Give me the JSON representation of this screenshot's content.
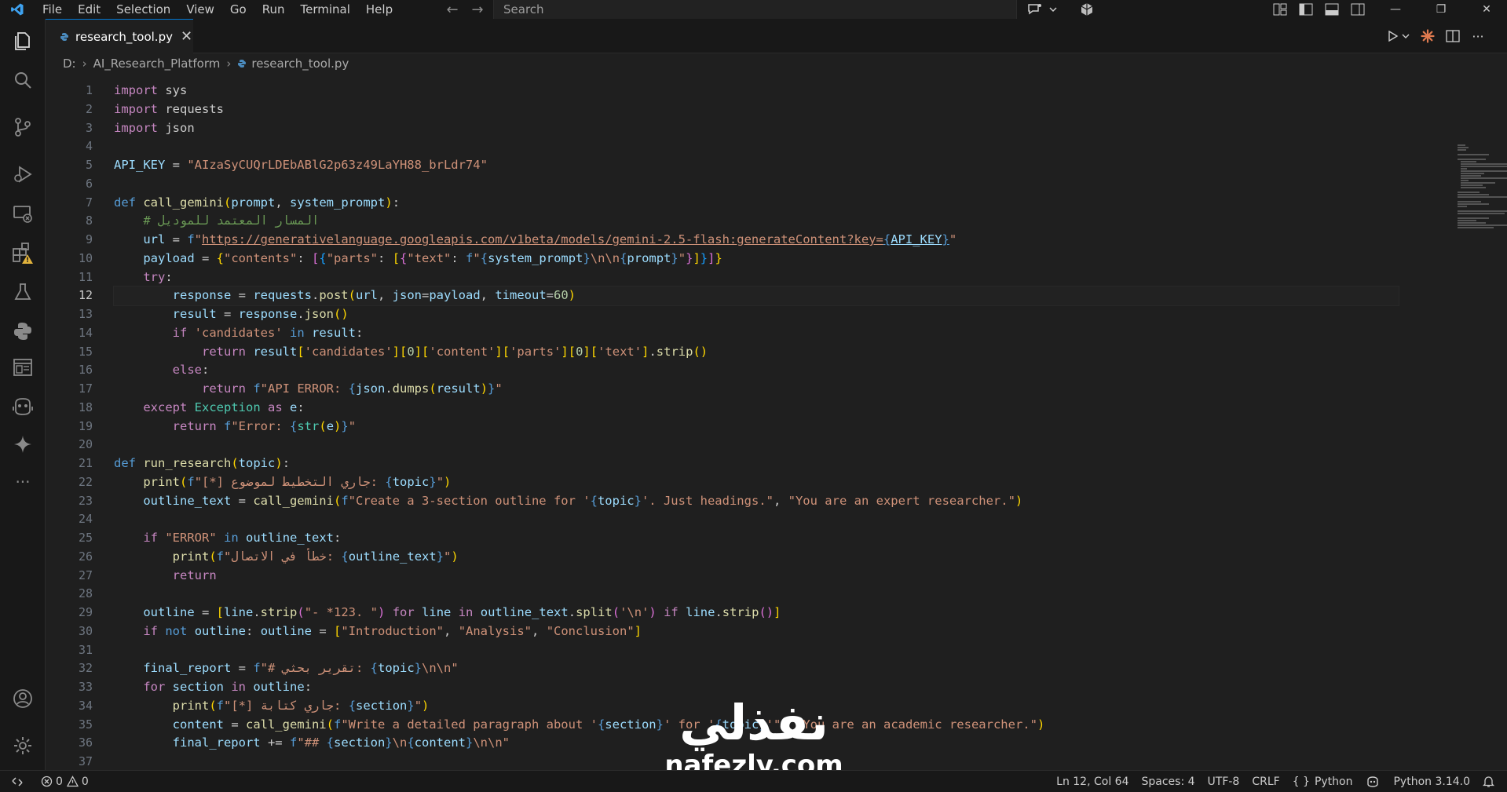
{
  "colors": {
    "accent": "#0078d4",
    "keyword": "#c586c0",
    "string": "#ce9178",
    "function": "#dcdcaa",
    "variable": "#9cdcfe",
    "builtin_type": "#4ec9b0",
    "number": "#b5cea8",
    "comment": "#6a9955"
  },
  "titlebar": {
    "menu": [
      "File",
      "Edit",
      "Selection",
      "View",
      "Go",
      "Run",
      "Terminal",
      "Help"
    ],
    "search_placeholder": "Search",
    "icons": [
      "vscode-logo-icon",
      "back-arrow-icon",
      "forward-arrow-icon",
      "copilot-chat-icon",
      "chevron-down-icon",
      "cube-icon",
      "customize-layout-icon",
      "toggle-sidebar-icon",
      "toggle-panel-icon",
      "toggle-secondary-sidebar-icon",
      "minimize-icon",
      "restore-icon",
      "close-icon"
    ]
  },
  "activitybar": {
    "icons": [
      "explorer-icon",
      "search-icon",
      "source-control-icon",
      "run-debug-icon",
      "remote-explorer-icon",
      "extensions-icon",
      "testing-icon",
      "python-icon",
      "preview-icon",
      "copilot-icon",
      "gemini-sparkle-icon",
      "more-icon",
      "account-icon",
      "settings-gear-icon"
    ]
  },
  "tab": {
    "label": "research_tool.py"
  },
  "breadcrumb": {
    "drive": "D:",
    "folder": "AI_Research_Platform",
    "file": "research_tool.py"
  },
  "editor": {
    "line_numbers": [
      "1",
      "2",
      "3",
      "4",
      "5",
      "6",
      "7",
      "8",
      "9",
      "10",
      "11",
      "12",
      "13",
      "14",
      "15",
      "16",
      "17",
      "18",
      "19",
      "20",
      "21",
      "22",
      "23",
      "24",
      "25",
      "26",
      "27",
      "28",
      "29",
      "30",
      "31",
      "32",
      "33",
      "34",
      "35",
      "36",
      "37"
    ],
    "active_line": 12
  },
  "watermark": {
    "arabic": "نفذلي",
    "latin": "nafezly.com"
  },
  "statusbar": {
    "errors": "0",
    "warnings": "0",
    "cursor": "Ln 12, Col 64",
    "spaces": "Spaces: 4",
    "encoding": "UTF-8",
    "eol": "CRLF",
    "language": "Python",
    "interpreter": "Python 3.14.0"
  }
}
